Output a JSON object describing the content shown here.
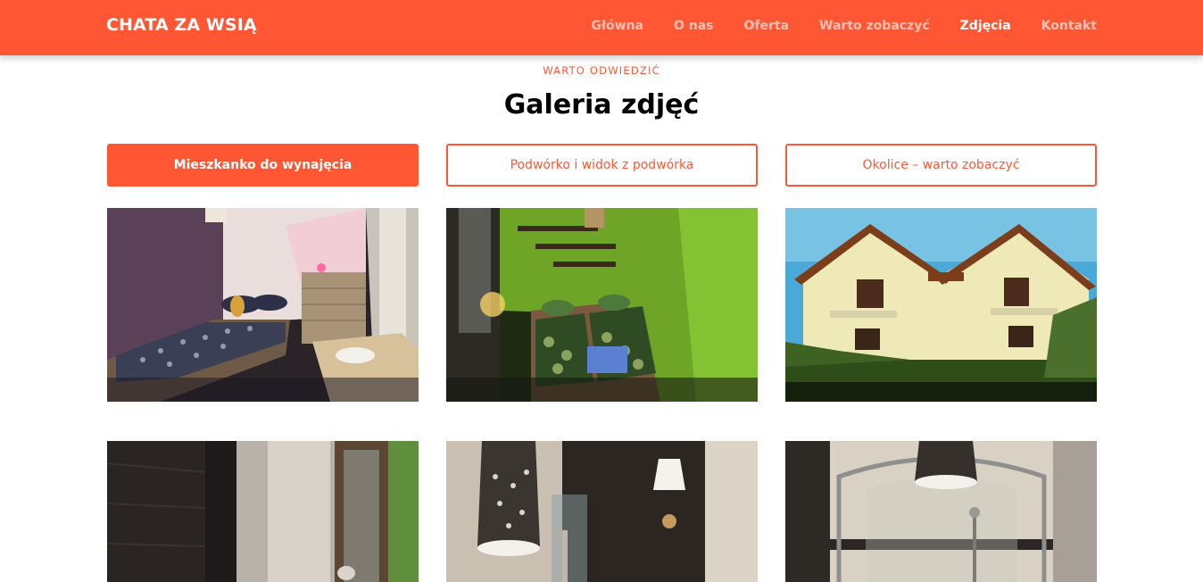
{
  "brand": "CHATA ZA WSIĄ",
  "nav": {
    "items": [
      {
        "label": "Główna"
      },
      {
        "label": "O nas"
      },
      {
        "label": "Oferta"
      },
      {
        "label": "Warto zobaczyć"
      },
      {
        "label": "Zdjęcia",
        "active": true
      },
      {
        "label": "Kontakt"
      }
    ]
  },
  "section": {
    "eyebrow": "WARTO ODWIEDZIĆ",
    "title": "Galeria zdjęć"
  },
  "filters": [
    {
      "label": "Mieszkanko do wynajęcia",
      "active": true
    },
    {
      "label": "Podwórko i widok z podwórka",
      "active": false
    },
    {
      "label": "Okolice – warto zobaczyć",
      "active": false
    }
  ],
  "colors": {
    "accent": "#ff5733",
    "nav_inactive": "rgba(255,255,255,0.62)",
    "text": "#000000"
  },
  "gallery": {
    "photos": [
      {
        "subject": "bedroom-purple-wall"
      },
      {
        "subject": "bedroom-green-wall"
      },
      {
        "subject": "house-exterior"
      },
      {
        "subject": "dark-room-window"
      },
      {
        "subject": "bathroom-lamp-sconce"
      },
      {
        "subject": "bathroom-shower"
      }
    ]
  }
}
